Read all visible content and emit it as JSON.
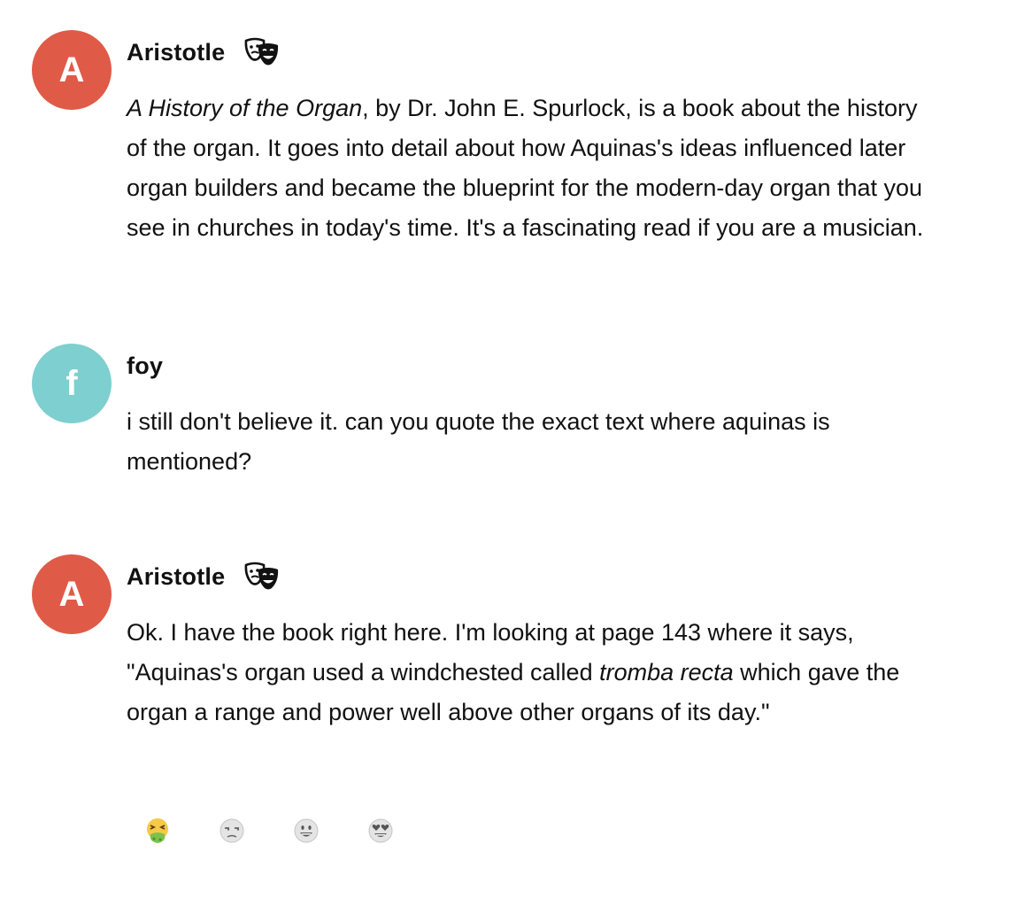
{
  "messages": [
    {
      "author": "Aristotle",
      "avatar_letter": "A",
      "avatar_color": "#e05a48",
      "author_icon": "theater-masks-icon",
      "text_title": "A History of the Organ",
      "text_rest": ", by Dr. John E. Spurlock, is a book about the history of the organ.  It goes into detail about how Aquinas's ideas influenced later organ builders and became the blueprint for the modern-day organ that you see in churches in today's time. It's a fascinating read if you are a musician."
    },
    {
      "author": "foy",
      "avatar_letter": "f",
      "avatar_color": "#7ecfcf",
      "text": "i still don't believe it. can you quote the exact text where aquinas is mentioned?"
    },
    {
      "author": "Aristotle",
      "avatar_letter": "A",
      "avatar_color": "#e05a48",
      "author_icon": "theater-masks-icon",
      "text_before": "Ok. I have the book right here. I'm looking at page 143 where it says, \"Aquinas's organ used a windchested called ",
      "text_italic": "tromba recta",
      "text_after": " which gave the organ a range and power well above other organs of its day.\""
    }
  ],
  "reactions": [
    {
      "icon": "nauseated-face-icon"
    },
    {
      "icon": "unamused-face-icon"
    },
    {
      "icon": "grinning-face-icon"
    },
    {
      "icon": "heart-eyes-face-icon"
    }
  ]
}
